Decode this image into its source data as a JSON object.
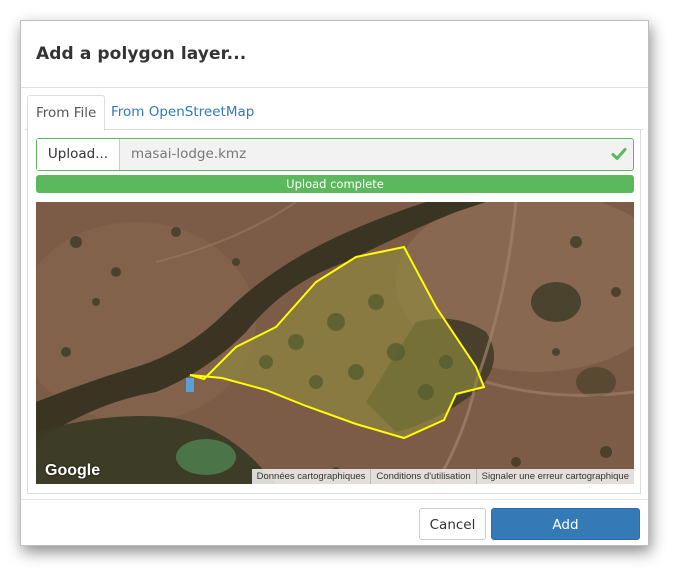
{
  "dialog": {
    "title": "Add a polygon layer..."
  },
  "tabs": [
    {
      "label": "From File",
      "active": true
    },
    {
      "label": "From OpenStreetMap",
      "active": false
    }
  ],
  "upload": {
    "button_label": "Upload...",
    "file_name": "masai-lodge.kmz",
    "status_icon": "check-icon",
    "progress_text": "Upload complete",
    "progress": 1.0
  },
  "map": {
    "provider_logo": "Google",
    "attribution": [
      "Données cartographiques",
      "Conditions d'utilisation",
      "Signaler une erreur cartographique"
    ],
    "polygon_color": "#ffff00"
  },
  "footer": {
    "cancel_label": "Cancel",
    "add_label": "Add"
  },
  "colors": {
    "accent": "#337ab7",
    "success": "#5cb85c"
  }
}
